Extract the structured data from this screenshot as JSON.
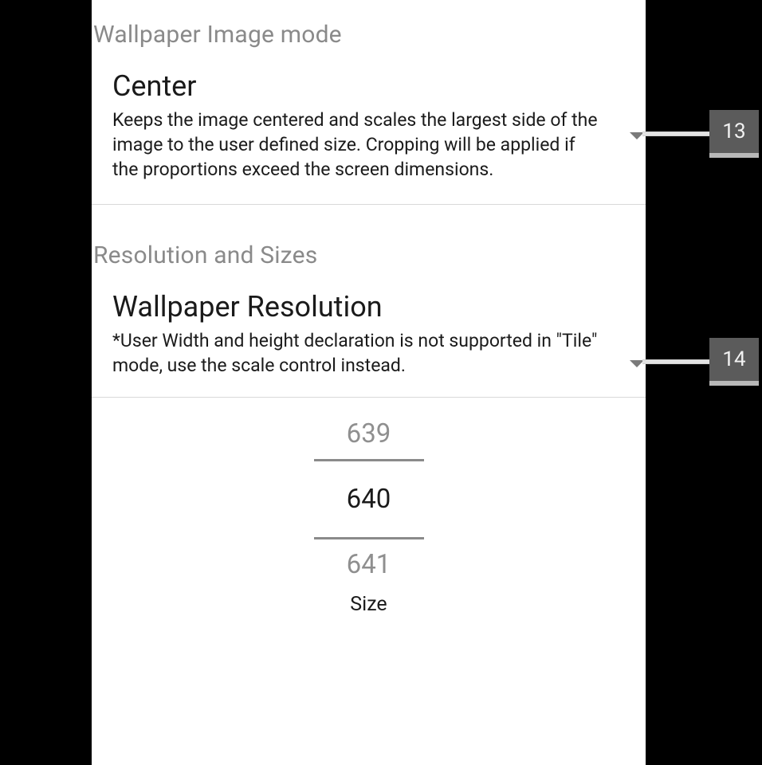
{
  "sections": {
    "wallpaper_mode": {
      "header": "Wallpaper Image mode",
      "item": {
        "title": "Center",
        "description": "Keeps the image centered and scales the largest side of the image to the user defined size. Cropping will be applied if the proportions exceed the screen dimensions."
      }
    },
    "resolution": {
      "header": "Resolution and Sizes",
      "item": {
        "title": "Wallpaper Resolution",
        "description": "*User Width and height declaration is not supported in \"Tile\" mode, use the scale control instead."
      },
      "picker": {
        "prev": "639",
        "current": "640",
        "next": "641",
        "caption": "Size"
      }
    }
  },
  "callouts": {
    "c1": "13",
    "c2": "14"
  }
}
